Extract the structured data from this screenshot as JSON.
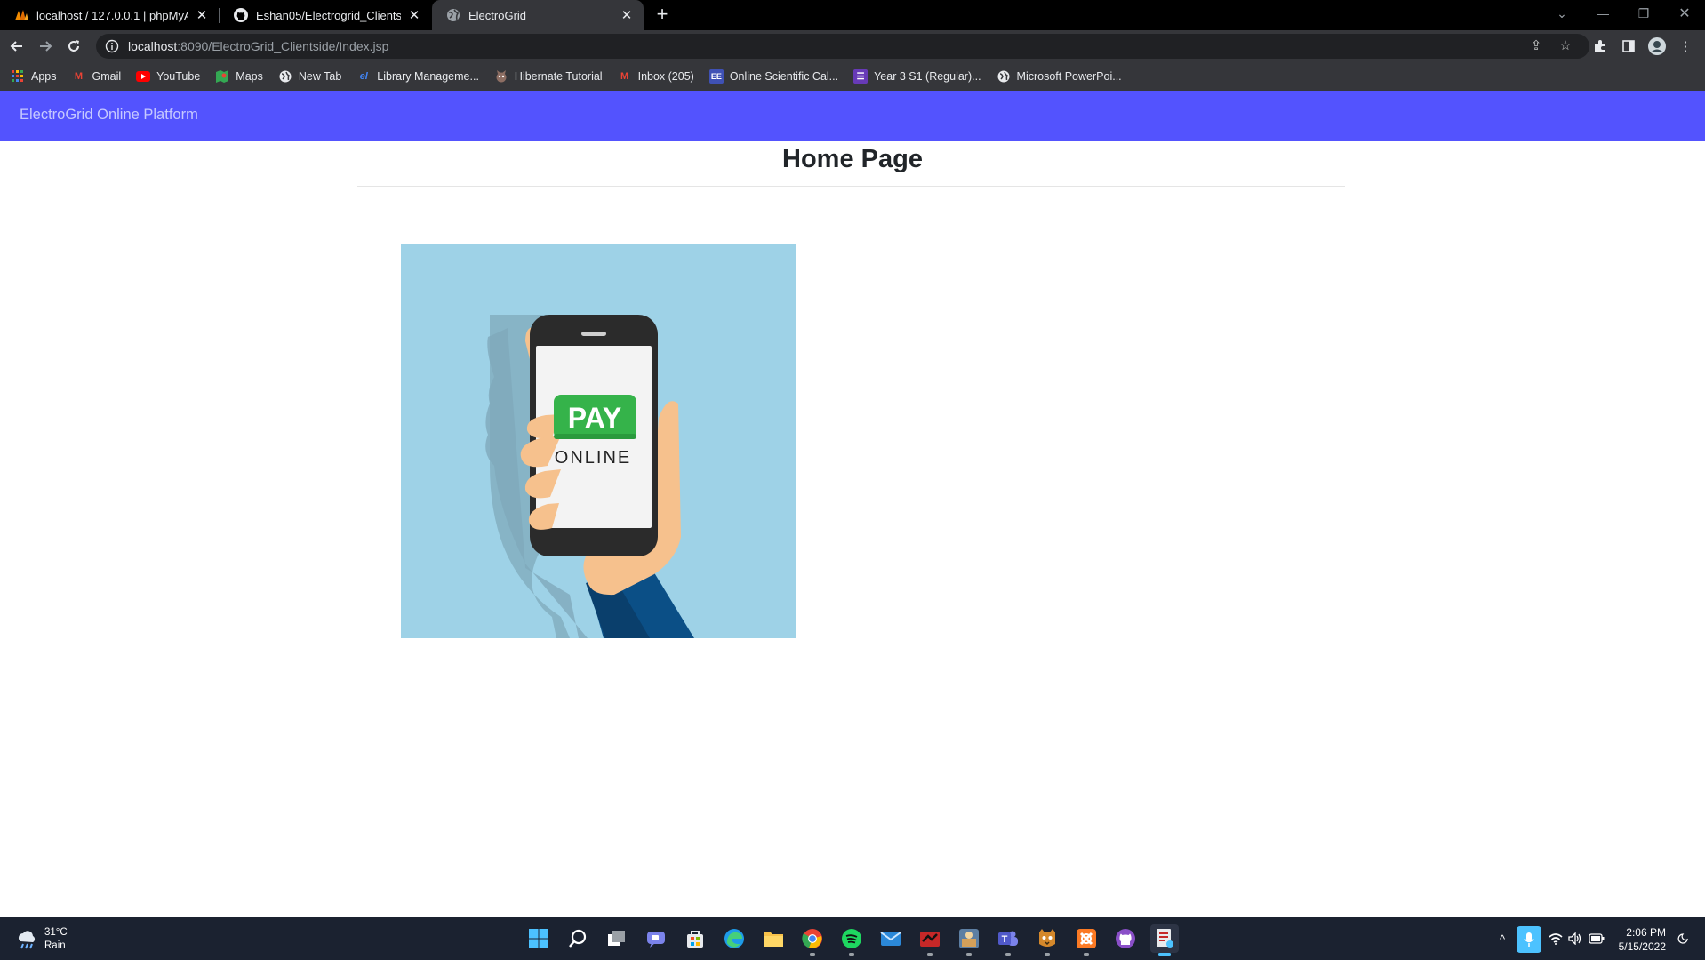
{
  "browser": {
    "tabs": [
      {
        "title": "localhost / 127.0.0.1 | phpMyAdmin",
        "favicon": "phpmyadmin-icon",
        "active": false
      },
      {
        "title": "Eshan05/Electrogrid_Clientside",
        "favicon": "github-icon",
        "active": false
      },
      {
        "title": "ElectroGrid",
        "favicon": "globe-icon",
        "active": true
      }
    ],
    "address": {
      "host": "localhost",
      "path": ":8090/ElectroGrid_Clientside/Index.jsp"
    },
    "bookmarks": [
      {
        "label": "Apps",
        "icon": "apps-grid-icon"
      },
      {
        "label": "Gmail",
        "icon": "gmail-icon"
      },
      {
        "label": "YouTube",
        "icon": "youtube-icon"
      },
      {
        "label": "Maps",
        "icon": "maps-icon"
      },
      {
        "label": "New Tab",
        "icon": "globe-icon"
      },
      {
        "label": "Library Manageme...",
        "icon": "library-icon"
      },
      {
        "label": "Hibernate Tutorial",
        "icon": "hibernate-icon"
      },
      {
        "label": "Inbox (205)",
        "icon": "gmail-icon"
      },
      {
        "label": "Online Scientific Cal...",
        "icon": "calculator-icon"
      },
      {
        "label": "Year 3 S1 (Regular)...",
        "icon": "list-icon"
      },
      {
        "label": "Microsoft PowerPoi...",
        "icon": "globe-icon"
      }
    ]
  },
  "page": {
    "brand": "ElectroGrid Online Platform",
    "heading": "Home Page",
    "image": {
      "alt": "pay-online-illustration",
      "pay_label": "PAY",
      "online_label": "ONLINE"
    }
  },
  "taskbar": {
    "weather": {
      "temp": "31°C",
      "condition": "Rain"
    },
    "time": "2:06 PM",
    "date": "5/15/2022"
  },
  "colors": {
    "navbar": "#5353fe",
    "image_bg": "#9ed2e7",
    "pay_button": "#35b34a"
  }
}
